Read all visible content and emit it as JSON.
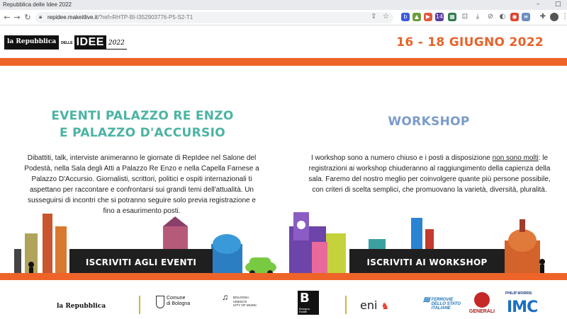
{
  "browser": {
    "tab_title": "Repubblica delle Idee 2022",
    "url_host": "repidee.makeitlive.it",
    "url_path": "/?ref=RHTP-BI-I352903776-P5-S2-T1",
    "window_controls": [
      "–",
      "□"
    ],
    "extension_badge": "14"
  },
  "header": {
    "logo_brand": "la Repubblica",
    "logo_delle": "DELLE",
    "logo_idee": "IDEE",
    "logo_year": "2022",
    "dates": "16 - 18 GIUGNO 2022"
  },
  "left_column": {
    "title_line1": "EVENTI PALAZZO RE ENZO",
    "title_line2": "E PALAZZO D'ACCURSIO",
    "body": "Dibattiti, talk, interviste animeranno le giornate di RepIdee nel Salone del Podestà, nella Sala degli Atti a Palazzo Re Enzo e nella Capella Farnese a Palazzo D'Accursio. Giornalisti, scrittori, politici e ospiti internazionali ti aspettano per raccontare e confrontarsi sui grandi temi dell'attualità. Un susseguirsi di incontri che si potranno seguire solo previa registrazione e fino a esaurimento posti.",
    "cta": "ISCRIVITI AGLI EVENTI"
  },
  "right_column": {
    "title": "WORKSHOP",
    "body_before": "I workshop sono a numero chiuso e i posti a disposizione ",
    "body_underlined": "non sono molti",
    "body_after": ": le registrazioni ai workshop chiuderanno al raggiungimento della capienza della sala. Faremo del nostro meglio per coinvolgere quante più persone possibile, con criteri di scelta semplici, che promuovano la varietà, diversità, pluralità.",
    "cta": "ISCRIVITI AI WORKSHOP"
  },
  "sponsors": {
    "repubblica": "la Repubblica",
    "comune_line1": "Comune",
    "comune_line2": "di Bologna",
    "unesco_line1": "BOLOGNA",
    "unesco_line2": "UNESCO",
    "unesco_line3": "CITY OF MUSIC",
    "bologna_estate_b": "B",
    "bologna_estate_line1": "Bologna",
    "bologna_estate_line2": "Estate",
    "eni": "eni",
    "fs_line1": "FERROVIE",
    "fs_line2": "DELLO STATO",
    "fs_line3": "ITALIANE",
    "generali": "GENERALI",
    "pm": "PHILIP MORRIS",
    "imc": "IMC"
  },
  "colors": {
    "brand_orange": "#ee6428",
    "teal_title": "#4bb3a3",
    "blue_title": "#7b9bcb",
    "cta_bg": "#1f1f1f"
  }
}
